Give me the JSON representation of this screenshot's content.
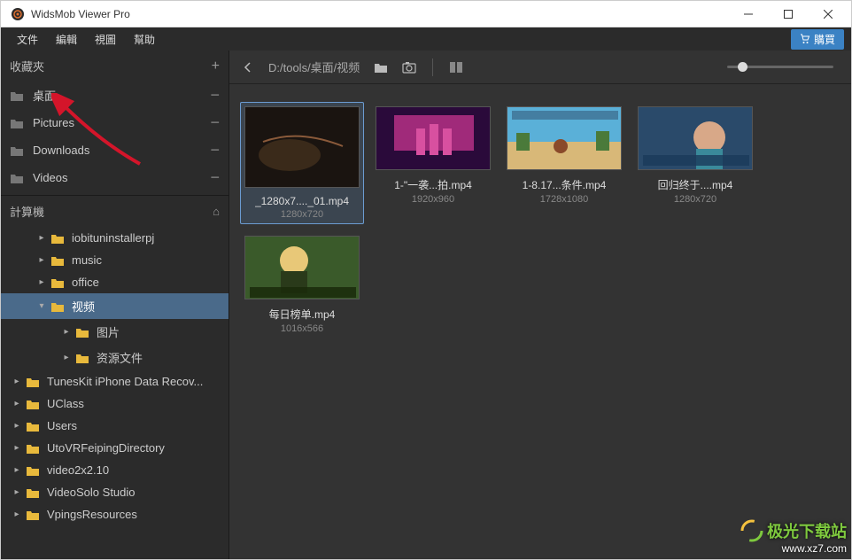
{
  "window": {
    "title": "WidsMob Viewer Pro"
  },
  "menu": {
    "items": [
      "文件",
      "編輯",
      "視圖",
      "幫助"
    ],
    "buy": "購買"
  },
  "sidebar": {
    "favorites": {
      "title": "收藏夾",
      "items": [
        {
          "label": "桌面"
        },
        {
          "label": "Pictures"
        },
        {
          "label": "Downloads"
        },
        {
          "label": "Videos"
        }
      ]
    },
    "computer": {
      "title": "計算機",
      "tree": [
        {
          "label": "iobituninstallerpj",
          "depth": 1,
          "expanded": false
        },
        {
          "label": "music",
          "depth": 1,
          "expanded": false
        },
        {
          "label": "office",
          "depth": 1,
          "expanded": false
        },
        {
          "label": "视频",
          "depth": 1,
          "expanded": true,
          "selected": true
        },
        {
          "label": "图片",
          "depth": 2,
          "expanded": false
        },
        {
          "label": "资源文件",
          "depth": 2,
          "expanded": false
        },
        {
          "label": "TunesKit iPhone Data Recov...",
          "depth": 0,
          "expanded": false
        },
        {
          "label": "UClass",
          "depth": 0,
          "expanded": false
        },
        {
          "label": "Users",
          "depth": 0,
          "expanded": false
        },
        {
          "label": "UtoVRFeipingDirectory",
          "depth": 0,
          "expanded": false
        },
        {
          "label": "video2x2.10",
          "depth": 0,
          "expanded": false
        },
        {
          "label": "VideoSolo Studio",
          "depth": 0,
          "expanded": false
        },
        {
          "label": "VpingsResources",
          "depth": 0,
          "expanded": false
        }
      ]
    }
  },
  "toolbar": {
    "breadcrumb": "D:/tools/桌面/视频"
  },
  "thumbnails": [
    {
      "name": "_1280x7...._01.mp4",
      "res": "1280x720",
      "selected": true,
      "bg": "dark"
    },
    {
      "name": "1-\"一袭...拍.mp4",
      "res": "1920x960",
      "bg": "stage"
    },
    {
      "name": "1-8.17...条件.mp4",
      "res": "1728x1080",
      "bg": "game"
    },
    {
      "name": "回归终于....mp4",
      "res": "1280x720",
      "bg": "studio"
    },
    {
      "name": "每日榜单.mp4",
      "res": "1016x566",
      "bg": "music"
    }
  ],
  "watermark": {
    "line1": "极光下载站",
    "line2": "www.xz7.com"
  }
}
